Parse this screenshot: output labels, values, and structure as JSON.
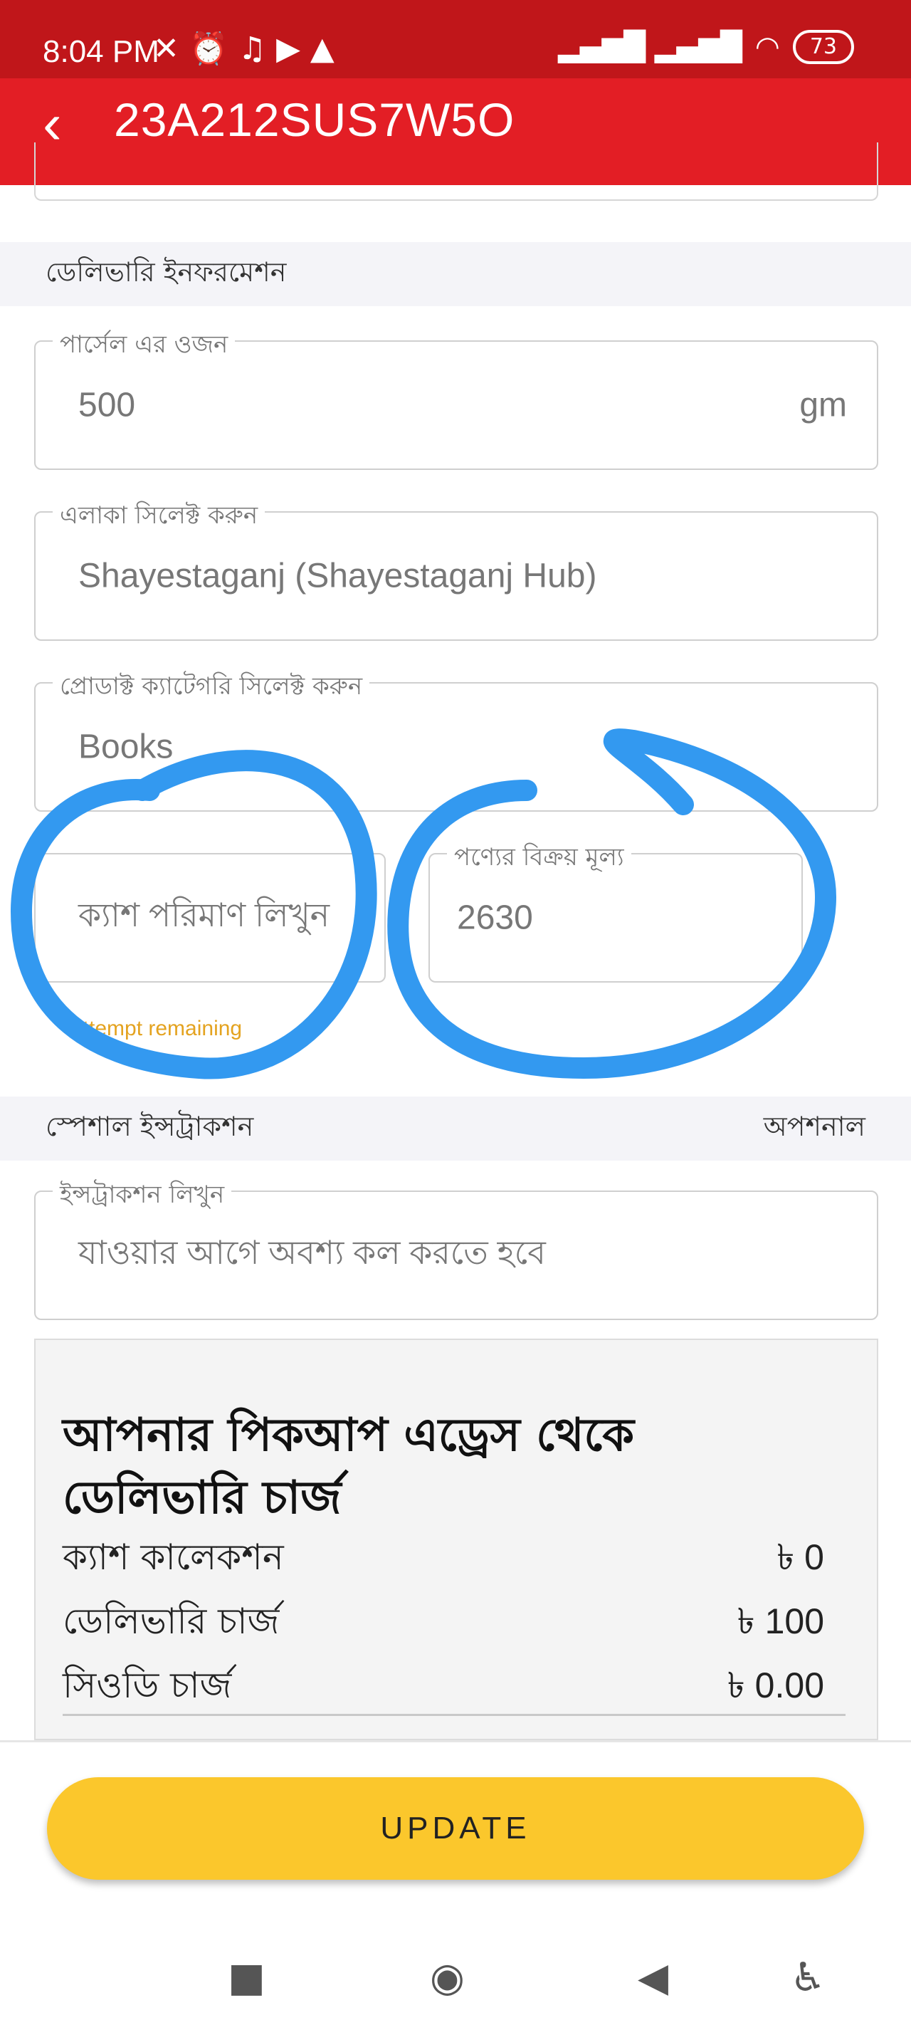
{
  "status_bar": {
    "time": "8:04 PM",
    "battery": "73"
  },
  "app_bar": {
    "back_icon": "chevron-left",
    "title": "23A212SUS7W5O"
  },
  "delivery_info": {
    "section_title": "ডেলিভারি ইনফরমেশন",
    "weight": {
      "label": "পার্সেল এর ওজন",
      "value": "500",
      "unit": "gm"
    },
    "area": {
      "label": "এলাকা সিলেক্ট করুন",
      "value": "Shayestaganj (Shayestaganj Hub)"
    },
    "category": {
      "label": "প্রোডাক্ট ক্যাটেগরি সিলেক্ট করুন",
      "value": "Books"
    },
    "cash_amount": {
      "placeholder": "ক্যাশ পরিমাণ লিখুন",
      "helper": "attempt remaining"
    },
    "sale_price": {
      "label": "পণ্যের বিক্রয় মূল্য",
      "value": "2630"
    }
  },
  "special_instruction": {
    "section_title": "স্পেশাল ইন্সট্রাকশন",
    "optional": "অপশনাল",
    "field": {
      "label": "ইন্সট্রাকশন লিখুন",
      "value": "যাওয়ার আগে অবশ্য কল করতে হবে"
    }
  },
  "charges": {
    "heading": "আপনার পিকআপ এড্রেস থেকে ডেলিভারি চার্জ",
    "rows": [
      {
        "label": "ক্যাশ কালেকশন",
        "value": "৳ 0"
      },
      {
        "label": "ডেলিভারি চার্জ",
        "value": "৳ 100"
      },
      {
        "label": "সিওডি চার্জ",
        "value": "৳ 0.00"
      }
    ]
  },
  "update_button": "UPDATE",
  "colors": {
    "status_bar": "#c0161a",
    "app_bar": "#e31e25",
    "update_button": "#fbc72c",
    "annotation_circle": "#3399f0",
    "helper_text": "#e4a320"
  }
}
